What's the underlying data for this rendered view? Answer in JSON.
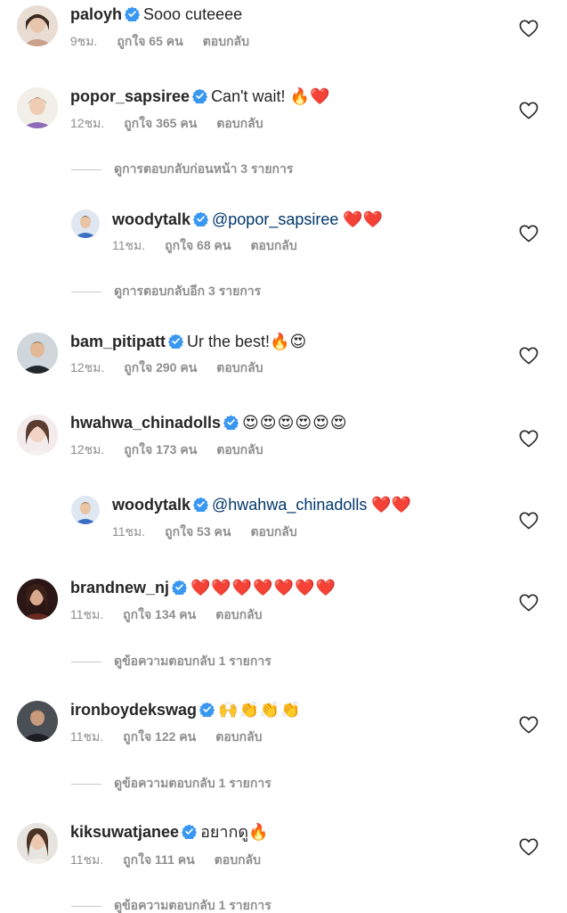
{
  "colors": {
    "verified": "#3897f0",
    "secondary_text": "#8e8e8e",
    "mention": "#00376b"
  },
  "labels": {
    "reply": "ตอบกลับ"
  },
  "comments": [
    {
      "username": "paloyh",
      "text": "Sooo cuteeee",
      "time": "9ชม.",
      "likes": "ถูกใจ 65 คน"
    },
    {
      "username": "popor_sapsiree",
      "text": "Can't wait! 🔥❤️",
      "time": "12ชม.",
      "likes": "ถูกใจ 365 คน"
    },
    {
      "username": "woodytalk",
      "mention": "@popor_sapsiree",
      "text": " ❤️❤️",
      "time": "11ชม.",
      "likes": "ถูกใจ 68 คน"
    },
    {
      "username": "bam_pitipatt",
      "text": "Ur the best!🔥😍",
      "time": "12ชม.",
      "likes": "ถูกใจ 290 คน"
    },
    {
      "username": "hwahwa_chinadolls",
      "text": "😍😍😍😍😍😍",
      "time": "12ชม.",
      "likes": "ถูกใจ 173 คน"
    },
    {
      "username": "woodytalk",
      "mention": "@hwahwa_chinadolls",
      "text": " ❤️❤️",
      "time": "11ชม.",
      "likes": "ถูกใจ 53 คน"
    },
    {
      "username": "brandnew_nj",
      "text": "❤️❤️❤️❤️❤️❤️❤️",
      "time": "11ชม.",
      "likes": "ถูกใจ 134 คน"
    },
    {
      "username": "ironboydekswag",
      "text": "🙌👏👏👏",
      "time": "11ชม.",
      "likes": "ถูกใจ 122 คน"
    },
    {
      "username": "kiksuwatjanee",
      "text": "อยากดู🔥",
      "time": "11ชม.",
      "likes": "ถูกใจ 111 คน"
    }
  ],
  "view_replies": [
    "ดูการตอบกลับก่อนหน้า 3 รายการ",
    "ดูการตอบกลับอีก 3 รายการ",
    "ดูข้อความตอบกลับ 1 รายการ",
    "ดูข้อความตอบกลับ 1 รายการ",
    "ดูข้อความตอบกลับ 1 รายการ"
  ]
}
